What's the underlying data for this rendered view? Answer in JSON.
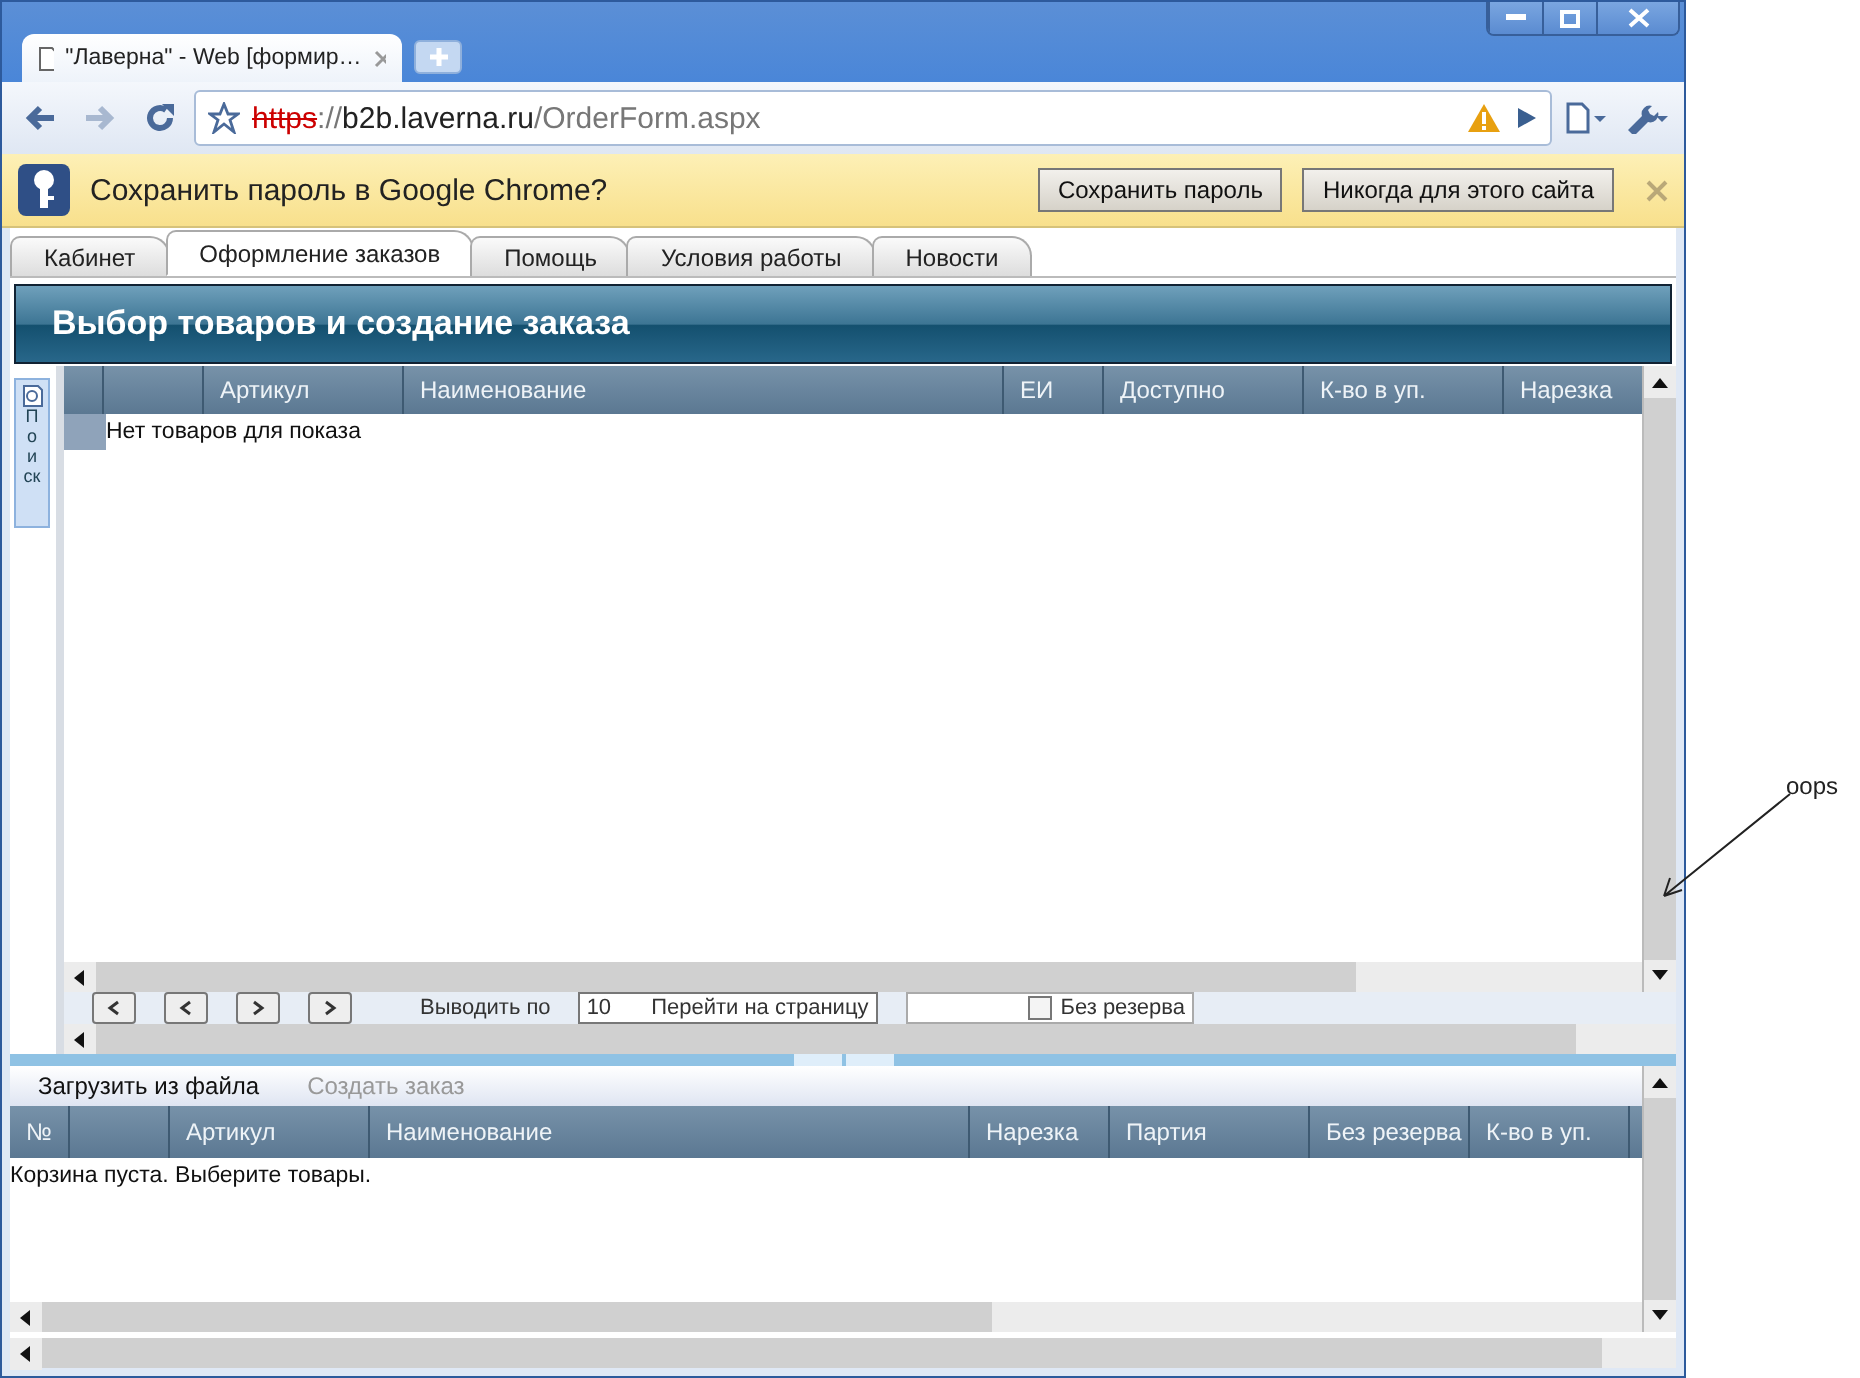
{
  "browser": {
    "tab_title": "\"Лаверна\" - Web [формир…",
    "url": {
      "scheme": "https",
      "separator": "://",
      "host": "b2b.laverna.ru",
      "path": "/OrderForm.aspx",
      "insecure": true
    }
  },
  "infobar": {
    "message": "Сохранить пароль в Google Chrome?",
    "buttons": [
      "Сохранить пароль",
      "Никогда для этого сайта"
    ]
  },
  "app_tabs": [
    {
      "label": "Кабинет",
      "selected": false
    },
    {
      "label": "Оформление заказов",
      "selected": true
    },
    {
      "label": "Помощь",
      "selected": false
    },
    {
      "label": "Условия работы",
      "selected": false
    },
    {
      "label": "Новости",
      "selected": false
    }
  ],
  "page_title": "Выбор товаров и создание заказа",
  "side_panel": {
    "label": "Поиск"
  },
  "products_table": {
    "columns": [
      "Артикул",
      "Наименование",
      "ЕИ",
      "Доступно",
      "К-во в уп.",
      "Нарезка"
    ],
    "empty_message": "Нет товаров для показа"
  },
  "pager": {
    "page_size_label": "Выводить по",
    "page_size_value": "10",
    "goto_label": "Перейти на страницу",
    "reserve": {
      "label": "Без резерва",
      "checked": false
    }
  },
  "cart": {
    "actions": [
      {
        "label": "Загрузить из файла",
        "disabled": false
      },
      {
        "label": "Создать заказ",
        "disabled": true
      }
    ],
    "columns": [
      "№",
      "Артикул",
      "Наименование",
      "Нарезка",
      "Партия",
      "Без резерва",
      "К-во в уп."
    ],
    "empty_message": "Корзина пуста. Выберите товары."
  },
  "annotation": "oops"
}
